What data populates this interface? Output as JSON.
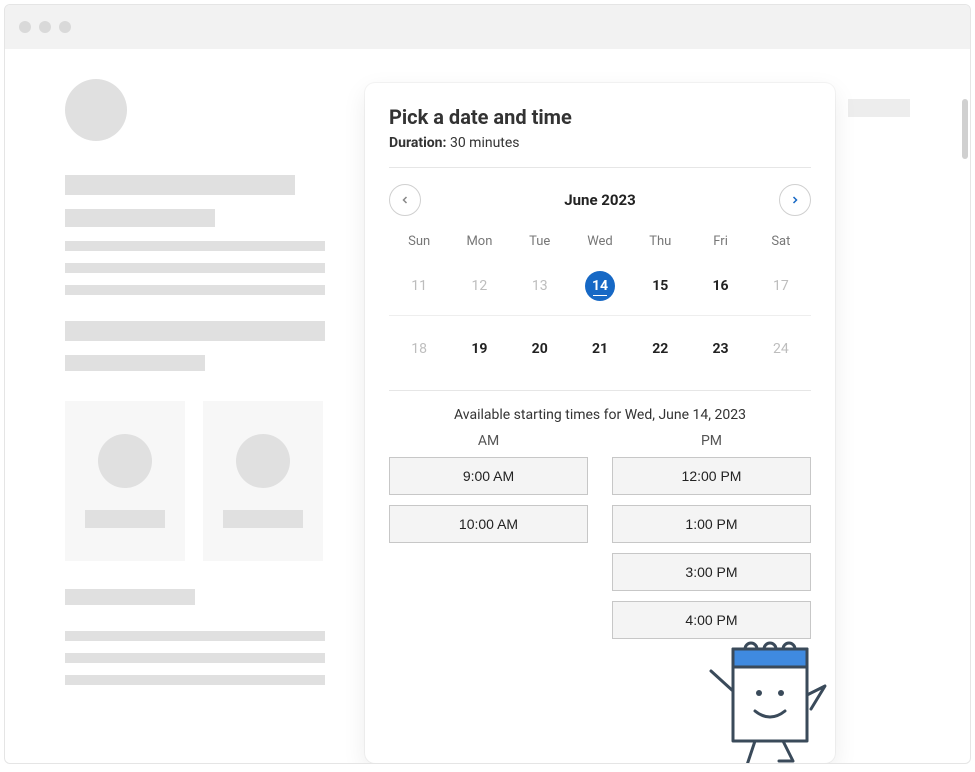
{
  "picker": {
    "title": "Pick a date and time",
    "duration_label": "Duration:",
    "duration_value": "30 minutes",
    "month_label": "June 2023",
    "dow": [
      "Sun",
      "Mon",
      "Tue",
      "Wed",
      "Thu",
      "Fri",
      "Sat"
    ],
    "rows": [
      [
        {
          "n": "11",
          "muted": true
        },
        {
          "n": "12",
          "muted": true
        },
        {
          "n": "13",
          "muted": true
        },
        {
          "n": "14",
          "selected": true
        },
        {
          "n": "15"
        },
        {
          "n": "16"
        },
        {
          "n": "17",
          "muted": true
        }
      ],
      [
        {
          "n": "18",
          "muted": true
        },
        {
          "n": "19"
        },
        {
          "n": "20"
        },
        {
          "n": "21"
        },
        {
          "n": "22"
        },
        {
          "n": "23"
        },
        {
          "n": "24",
          "muted": true
        }
      ]
    ],
    "available_heading": "Available starting times for Wed, June 14, 2023",
    "am_label": "AM",
    "pm_label": "PM",
    "am_slots": [
      "9:00 AM",
      "10:00 AM"
    ],
    "pm_slots": [
      "12:00 PM",
      "1:00 PM",
      "3:00 PM",
      "4:00 PM"
    ]
  },
  "icons": {
    "prev": "chevron-left-icon",
    "next": "chevron-right-icon"
  },
  "colors": {
    "accent": "#1668c5"
  }
}
